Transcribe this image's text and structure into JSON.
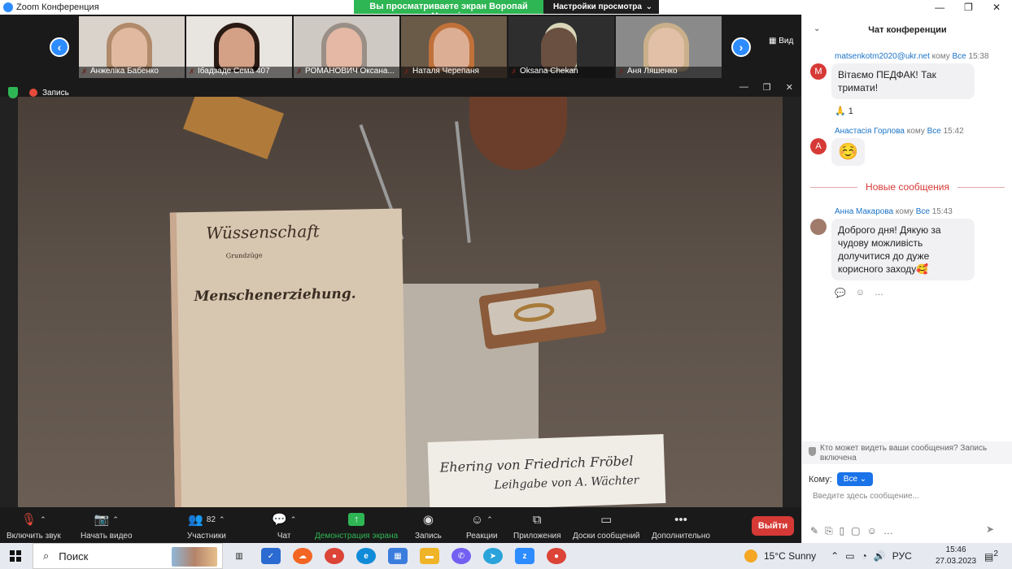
{
  "window": {
    "title": "Zoom Конференция",
    "share_banner": "Вы просматриваете экран Воропай Наталія",
    "view_options": "Настройки просмотра",
    "view_options_caret": "⌄",
    "minimize": "—",
    "maximize": "❐",
    "close": "✕"
  },
  "gallery": {
    "prev": "‹",
    "next": "›",
    "view_label": "▦ Вид",
    "participants": [
      {
        "name": "Анжеліка Бабенко"
      },
      {
        "name": "Ібадзаде Сема 407"
      },
      {
        "name": "РОМАНОВИЧ Оксана..."
      },
      {
        "name": "Наталя Черепаня"
      },
      {
        "name": "Oksana Chekan"
      },
      {
        "name": "Аня Ляшенко"
      }
    ]
  },
  "share": {
    "recording_label": "Запись",
    "book_title": "Menschenerziehung.",
    "book_header": "Wüssenschaft",
    "book_sub": "Grundzüge",
    "card_line1": "Ehering von Friedrich Fröbel",
    "card_line2": "Leihgabe von A. Wächter"
  },
  "toolbar": {
    "audio": "Включить звук",
    "video": "Начать видео",
    "participants": "Участники",
    "participants_count": "82",
    "chat": "Чат",
    "share": "Демонстрация экрана",
    "record": "Запись",
    "reactions": "Реакции",
    "apps": "Приложения",
    "whiteboards": "Доски сообщений",
    "more": "Дополнительно",
    "leave": "Выйти"
  },
  "chat": {
    "title": "Чат конференции",
    "collapse": "⌄",
    "to_word": "кому",
    "to_all": "Все",
    "messages": [
      {
        "avatar": "M",
        "avatar_color": "#d63a36",
        "sender": "matsenkotm2020@ukr.net",
        "time": "15:38",
        "text": "Вітаємо ПЕДФАК! Так тримати!",
        "reaction": "🙏 1"
      },
      {
        "avatar": "A",
        "avatar_color": "#d63a36",
        "sender": "Анастасія Горлова",
        "time": "15:42",
        "text": "☺️"
      },
      {
        "avatar": "",
        "avatar_color": "#a07a6a",
        "sender": "Анна Макарова",
        "time": "15:43",
        "text": "Доброго дня! Дякую за чудову можливість долучитися до дуже корисного заходу🥰"
      }
    ],
    "new_messages": "Новые сообщения",
    "notice": "Кто может видеть ваши сообщения? Запись включена",
    "to_label": "Кому:",
    "to_value": "Все",
    "compose_placeholder": "Введите здесь сообщение..."
  },
  "taskbar": {
    "search": "Поиск",
    "weather": "15°C  Sunny",
    "lang": "РУС",
    "time": "15:46",
    "date": "27.03.2023",
    "notifications": "2"
  }
}
